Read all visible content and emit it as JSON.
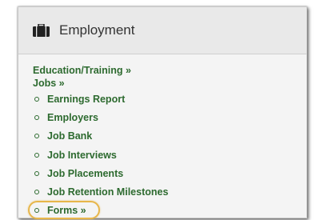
{
  "panel": {
    "title": "Employment",
    "icon": "briefcase-icon"
  },
  "categories": [
    {
      "label": "Education/Training »"
    },
    {
      "label": "Jobs »"
    }
  ],
  "jobs_items": [
    {
      "label": "Earnings Report"
    },
    {
      "label": "Employers"
    },
    {
      "label": "Job Bank"
    },
    {
      "label": "Job Interviews"
    },
    {
      "label": "Job Placements"
    },
    {
      "label": "Job Retention Milestones"
    },
    {
      "label": "Forms »",
      "highlighted": true
    }
  ],
  "colors": {
    "link": "#2d6a2f",
    "highlight": "#e7b64a"
  }
}
